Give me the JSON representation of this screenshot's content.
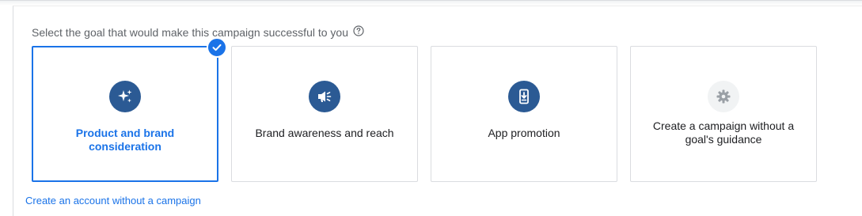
{
  "prompt": {
    "text": "Select the goal that would make this campaign successful to you",
    "help_icon": "help-circle-icon"
  },
  "goals": [
    {
      "label": "Product and brand consideration",
      "icon": "sparkle-icon",
      "selected": true
    },
    {
      "label": "Brand awareness and reach",
      "icon": "megaphone-icon",
      "selected": false
    },
    {
      "label": "App promotion",
      "icon": "phone-download-icon",
      "selected": false
    },
    {
      "label": "Create a campaign without a goal's guidance",
      "icon": "gear-icon",
      "selected": false
    }
  ],
  "link": {
    "text": "Create an account without a campaign"
  },
  "colors": {
    "accent": "#1a73e8",
    "icon_bg": "#2b5a94",
    "text": "#202124",
    "muted": "#5f6368",
    "border": "#dadce0"
  }
}
